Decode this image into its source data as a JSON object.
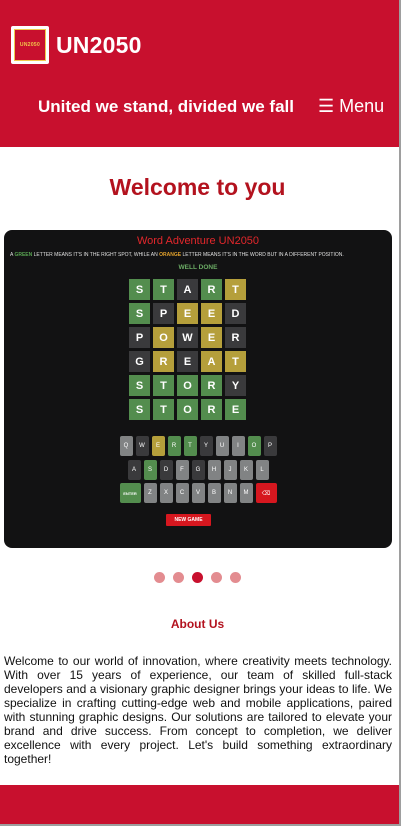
{
  "header": {
    "logo_text": "UN2050",
    "brand": "UN2050",
    "tagline": "United we stand, divided we fall",
    "menu_label": "☰ Menu",
    "accent_color": "#c8102e"
  },
  "welcome_heading": "Welcome to you",
  "carousel": {
    "active_index": 2,
    "slide_count": 5,
    "slide": {
      "title": "Word Adventure UN2050",
      "rules": {
        "part1": "A ",
        "green_word": "GREEN",
        "part2": " LETTER MEANS IT'S IN THE RIGHT SPOT, WHILE AN ",
        "orange_word": "ORANGE",
        "part3": " LETTER MEANS IT'S IN THE WORD BUT IN A DIFFERENT POSITION."
      },
      "status": "WELL DONE",
      "board": [
        [
          {
            "l": "S",
            "s": "green"
          },
          {
            "l": "T",
            "s": "green"
          },
          {
            "l": "A",
            "s": "gray"
          },
          {
            "l": "R",
            "s": "green"
          },
          {
            "l": "T",
            "s": "yellow"
          }
        ],
        [
          {
            "l": "S",
            "s": "green"
          },
          {
            "l": "P",
            "s": "gray"
          },
          {
            "l": "E",
            "s": "yellow"
          },
          {
            "l": "E",
            "s": "yellow"
          },
          {
            "l": "D",
            "s": "gray"
          }
        ],
        [
          {
            "l": "P",
            "s": "gray"
          },
          {
            "l": "O",
            "s": "yellow"
          },
          {
            "l": "W",
            "s": "gray"
          },
          {
            "l": "E",
            "s": "yellow"
          },
          {
            "l": "R",
            "s": "gray"
          }
        ],
        [
          {
            "l": "G",
            "s": "gray"
          },
          {
            "l": "R",
            "s": "yellow"
          },
          {
            "l": "E",
            "s": "gray"
          },
          {
            "l": "A",
            "s": "yellow"
          },
          {
            "l": "T",
            "s": "yellow"
          }
        ],
        [
          {
            "l": "S",
            "s": "green"
          },
          {
            "l": "T",
            "s": "green"
          },
          {
            "l": "O",
            "s": "green"
          },
          {
            "l": "R",
            "s": "green"
          },
          {
            "l": "Y",
            "s": "gray"
          }
        ],
        [
          {
            "l": "S",
            "s": "green"
          },
          {
            "l": "T",
            "s": "green"
          },
          {
            "l": "O",
            "s": "green"
          },
          {
            "l": "R",
            "s": "green"
          },
          {
            "l": "E",
            "s": "green"
          }
        ]
      ],
      "keyboard": [
        [
          {
            "k": "Q",
            "s": "light"
          },
          {
            "k": "W",
            "s": "dark"
          },
          {
            "k": "E",
            "s": "yellow"
          },
          {
            "k": "R",
            "s": "green"
          },
          {
            "k": "T",
            "s": "green"
          },
          {
            "k": "Y",
            "s": "dark"
          },
          {
            "k": "U",
            "s": "light"
          },
          {
            "k": "I",
            "s": "light"
          },
          {
            "k": "O",
            "s": "green"
          },
          {
            "k": "P",
            "s": "dark"
          }
        ],
        [
          {
            "k": "A",
            "s": "dark"
          },
          {
            "k": "S",
            "s": "green"
          },
          {
            "k": "D",
            "s": "dark"
          },
          {
            "k": "F",
            "s": "light"
          },
          {
            "k": "G",
            "s": "dark"
          },
          {
            "k": "H",
            "s": "light"
          },
          {
            "k": "J",
            "s": "light"
          },
          {
            "k": "K",
            "s": "light"
          },
          {
            "k": "L",
            "s": "light"
          }
        ],
        [
          {
            "k": "ENTER",
            "s": "enter"
          },
          {
            "k": "Z",
            "s": "light"
          },
          {
            "k": "X",
            "s": "light"
          },
          {
            "k": "C",
            "s": "light"
          },
          {
            "k": "V",
            "s": "light"
          },
          {
            "k": "B",
            "s": "light"
          },
          {
            "k": "N",
            "s": "light"
          },
          {
            "k": "M",
            "s": "light"
          },
          {
            "k": "⌫",
            "s": "del"
          }
        ]
      ],
      "new_game_label": "NEW GAME"
    }
  },
  "about": {
    "title": "About Us",
    "body": "Welcome to our world of innovation, where creativity meets technology. With over 15 years of experience, our team of skilled full-stack developers and a visionary graphic designer brings your ideas to life. We specialize in crafting cutting-edge web and mobile applications, paired with stunning graphic designs. Our solutions are tailored to elevate your brand and drive success. From concept to completion, we deliver excellence with every project. Let's build something extraordinary together!"
  }
}
